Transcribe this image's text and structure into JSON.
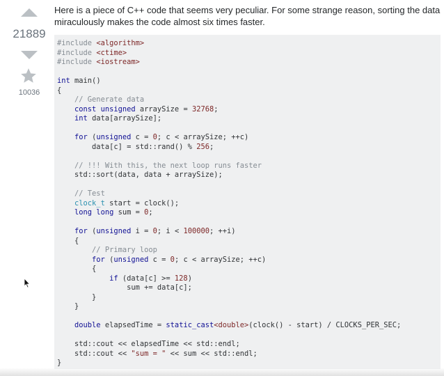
{
  "question": {
    "text": "Here is a piece of C++ code that seems very peculiar. For some strange reason, sorting the data miraculously makes the code almost six times faster.",
    "vote_count": "21889",
    "favorite_count": "10036"
  },
  "icons": {
    "upvote": "upvote-arrow-icon",
    "downvote": "downvote-arrow-icon",
    "favorite": "star-icon",
    "cursor": "mouse-cursor-icon"
  },
  "colors": {
    "code_background": "#eff0f1",
    "keyword": "#101094",
    "comment": "#858c93",
    "string": "#7d2727",
    "type": "#2b91af"
  },
  "code": [
    [
      [
        "com",
        "#include "
      ],
      [
        "str",
        "<algorithm>"
      ]
    ],
    [
      [
        "com",
        "#include "
      ],
      [
        "str",
        "<ctime>"
      ]
    ],
    [
      [
        "com",
        "#include "
      ],
      [
        "str",
        "<iostream>"
      ]
    ],
    [],
    [
      [
        "kw",
        "int"
      ],
      [
        "pln",
        " main()"
      ]
    ],
    [
      [
        "pln",
        "{"
      ]
    ],
    [
      [
        "pln",
        "    "
      ],
      [
        "com",
        "// Generate data"
      ]
    ],
    [
      [
        "pln",
        "    "
      ],
      [
        "kw",
        "const unsigned"
      ],
      [
        "pln",
        " arraySize = "
      ],
      [
        "num",
        "32768"
      ],
      [
        "pln",
        ";"
      ]
    ],
    [
      [
        "pln",
        "    "
      ],
      [
        "kw",
        "int"
      ],
      [
        "pln",
        " data[arraySize];"
      ]
    ],
    [],
    [
      [
        "pln",
        "    "
      ],
      [
        "kw",
        "for"
      ],
      [
        "pln",
        " ("
      ],
      [
        "kw",
        "unsigned"
      ],
      [
        "pln",
        " c = "
      ],
      [
        "num",
        "0"
      ],
      [
        "pln",
        "; c < arraySize; ++c)"
      ]
    ],
    [
      [
        "pln",
        "        data[c] = std::rand() % "
      ],
      [
        "num",
        "256"
      ],
      [
        "pln",
        ";"
      ]
    ],
    [],
    [
      [
        "pln",
        "    "
      ],
      [
        "com",
        "// !!! With this, the next loop runs faster"
      ]
    ],
    [
      [
        "pln",
        "    std::sort(data, data + arraySize);"
      ]
    ],
    [],
    [
      [
        "pln",
        "    "
      ],
      [
        "com",
        "// Test"
      ]
    ],
    [
      [
        "pln",
        "    "
      ],
      [
        "type",
        "clock_t"
      ],
      [
        "pln",
        " start = clock();"
      ]
    ],
    [
      [
        "pln",
        "    "
      ],
      [
        "kw",
        "long long"
      ],
      [
        "pln",
        " sum = "
      ],
      [
        "num",
        "0"
      ],
      [
        "pln",
        ";"
      ]
    ],
    [],
    [
      [
        "pln",
        "    "
      ],
      [
        "kw",
        "for"
      ],
      [
        "pln",
        " ("
      ],
      [
        "kw",
        "unsigned"
      ],
      [
        "pln",
        " i = "
      ],
      [
        "num",
        "0"
      ],
      [
        "pln",
        "; i < "
      ],
      [
        "num",
        "100000"
      ],
      [
        "pln",
        "; ++i)"
      ]
    ],
    [
      [
        "pln",
        "    {"
      ]
    ],
    [
      [
        "pln",
        "        "
      ],
      [
        "com",
        "// Primary loop"
      ]
    ],
    [
      [
        "pln",
        "        "
      ],
      [
        "kw",
        "for"
      ],
      [
        "pln",
        " ("
      ],
      [
        "kw",
        "unsigned"
      ],
      [
        "pln",
        " c = "
      ],
      [
        "num",
        "0"
      ],
      [
        "pln",
        "; c < arraySize; ++c)"
      ]
    ],
    [
      [
        "pln",
        "        {"
      ]
    ],
    [
      [
        "pln",
        "            "
      ],
      [
        "kw",
        "if"
      ],
      [
        "pln",
        " (data[c] >= "
      ],
      [
        "num",
        "128"
      ],
      [
        "pln",
        ")"
      ]
    ],
    [
      [
        "pln",
        "                sum += data[c];"
      ]
    ],
    [
      [
        "pln",
        "        }"
      ]
    ],
    [
      [
        "pln",
        "    }"
      ]
    ],
    [],
    [
      [
        "pln",
        "    "
      ],
      [
        "kw",
        "double"
      ],
      [
        "pln",
        " elapsedTime = "
      ],
      [
        "kw",
        "static_cast"
      ],
      [
        "str",
        "<double>"
      ],
      [
        "pln",
        "(clock() - start) / CLOCKS_PER_SEC;"
      ]
    ],
    [],
    [
      [
        "pln",
        "    std::cout << elapsedTime << std::endl;"
      ]
    ],
    [
      [
        "pln",
        "    std::cout << "
      ],
      [
        "str",
        "\"sum = \""
      ],
      [
        "pln",
        " << sum << std::endl;"
      ]
    ],
    [
      [
        "pln",
        "}"
      ]
    ]
  ]
}
